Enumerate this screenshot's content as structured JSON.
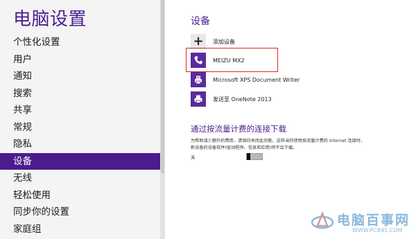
{
  "left_pane": {
    "title": "电脑设置",
    "nav_items": [
      {
        "label": "个性化设置",
        "active": false
      },
      {
        "label": "用户",
        "active": false
      },
      {
        "label": "通知",
        "active": false
      },
      {
        "label": "搜索",
        "active": false
      },
      {
        "label": "共享",
        "active": false
      },
      {
        "label": "常规",
        "active": false
      },
      {
        "label": "隐私",
        "active": false
      },
      {
        "label": "设备",
        "active": true
      },
      {
        "label": "无线",
        "active": false
      },
      {
        "label": "轻松使用",
        "active": false
      },
      {
        "label": "同步你的设置",
        "active": false
      },
      {
        "label": "家庭组",
        "active": false
      }
    ]
  },
  "devices": {
    "title": "设备",
    "add_label": "添加设备",
    "items": [
      {
        "name": "MEIZU MX2",
        "icon": "phone-icon"
      },
      {
        "name": "Microsoft XPS Document Writer",
        "icon": "document-printer-icon"
      },
      {
        "name": "发送至 OneNote 2013",
        "icon": "printer-icon"
      }
    ]
  },
  "metered": {
    "title": "通过按流量计费的连接下载",
    "description": "为帮助减少额外的费用，请保持关闭此功能，这样当你使用按流量计费的 Internet 连接时，新设备的设备软件(驱动程序、信息和应用)将不会下载。",
    "toggle_label": "关",
    "toggle_on": false
  },
  "watermark": {
    "name": "电脑百事网",
    "url": "WWW.PC841.COM"
  },
  "colors": {
    "accent": "#4a1c8d",
    "highlight_border": "#d42a2a",
    "watermark": "#8bb8dc"
  }
}
